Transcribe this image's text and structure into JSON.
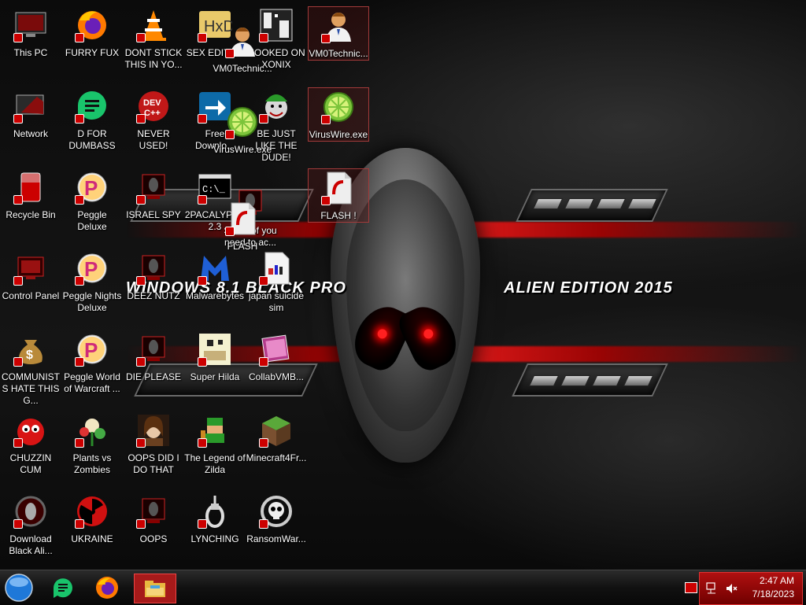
{
  "wallpaper": {
    "title_left": "WINDOWS 8.1 BLACK PRO",
    "title_right": "ALIEN EDITION 2015"
  },
  "desktop_icons": [
    {
      "label": "This PC",
      "icon": "monitor-icon"
    },
    {
      "label": "FURRY FUX",
      "icon": "firefox-icon"
    },
    {
      "label": "DONT STICK THIS IN YO...",
      "icon": "vlc-cone-icon"
    },
    {
      "label": "SEX EDITOR",
      "icon": "hex-editor-icon"
    },
    {
      "label": "HOOKED ON XONIX",
      "icon": "xonix-icon"
    },
    {
      "label": "VM0Technic...",
      "icon": "doctor-avatar-icon"
    },
    {
      "label": "VM0Technic...",
      "icon": "doctor-avatar-icon"
    },
    {
      "label": "Network",
      "icon": "network-icon"
    },
    {
      "label": "D FOR DUMBASS",
      "icon": "chat-app-icon"
    },
    {
      "label": "NEVER USED!",
      "icon": "dev-cpp-icon"
    },
    {
      "label": "Free Downlo...",
      "icon": "download-arrow-icon"
    },
    {
      "label": "BE JUST LIKE THE DUDE!",
      "icon": "santa-elf-icon"
    },
    {
      "label": "VirusWire.exe",
      "icon": "lime-icon"
    },
    {
      "label": "VirusWire.exe",
      "icon": "lime-icon"
    },
    {
      "label": "Recycle Bin",
      "icon": "recycle-bin-icon"
    },
    {
      "label": "Peggle Deluxe",
      "icon": "peggle-icon"
    },
    {
      "label": "ISRAEL SPY",
      "icon": "alien-monitor-icon"
    },
    {
      "label": "2PACALYPSE 2.3",
      "icon": "terminal-icon"
    },
    {
      "label": "Some of you need to ac...",
      "icon": "alien-monitor-icon"
    },
    {
      "label": "FLASH",
      "icon": "flash-file-icon"
    },
    {
      "label": "FLASH !",
      "icon": "flash-file-icon"
    },
    {
      "label": "Control Panel",
      "icon": "control-panel-icon"
    },
    {
      "label": "Peggle Nights Deluxe",
      "icon": "peggle-icon"
    },
    {
      "label": "DEEZ NUTZ",
      "icon": "alien-monitor-icon"
    },
    {
      "label": "Malwarebytes",
      "icon": "malwarebytes-icon"
    },
    {
      "label": "japan suicide sim",
      "icon": "document-icon"
    },
    {
      "label": "COMMUNISTS HATE THIS G...",
      "icon": "money-bag-icon"
    },
    {
      "label": "Peggle World of Warcraft ...",
      "icon": "peggle-icon"
    },
    {
      "label": "DIE PLEASE",
      "icon": "alien-monitor-icon"
    },
    {
      "label": "Super Hilda",
      "icon": "pixel-game-icon"
    },
    {
      "label": "CollabVMB...",
      "icon": "collabvm-icon"
    },
    {
      "label": "CHUZZIN CUM",
      "icon": "chuzzle-icon"
    },
    {
      "label": "Plants vs Zombies",
      "icon": "plant-icon"
    },
    {
      "label": "OOPS DID I DO THAT",
      "icon": "portrait-icon"
    },
    {
      "label": "The Legend of Zilda",
      "icon": "zelda-sprite-icon"
    },
    {
      "label": "Minecraft4Fr...",
      "icon": "grass-block-icon"
    },
    {
      "label": "Download Black Ali...",
      "icon": "alien-orb-icon"
    },
    {
      "label": "UKRAINE",
      "icon": "radiation-icon"
    },
    {
      "label": "OOPS",
      "icon": "alien-monitor-icon"
    },
    {
      "label": "LYNCHING",
      "icon": "noose-icon"
    },
    {
      "label": "RansomWar...",
      "icon": "skull-ring-icon"
    }
  ],
  "taskbar": {
    "buttons": [
      {
        "name": "start",
        "icon": "start-orb-icon"
      },
      {
        "name": "chat",
        "icon": "chat-app-icon"
      },
      {
        "name": "firefox",
        "icon": "firefox-icon"
      },
      {
        "name": "explorer",
        "icon": "folder-icon"
      }
    ],
    "clock_time": "2:47 AM",
    "clock_date": "7/18/2023"
  }
}
